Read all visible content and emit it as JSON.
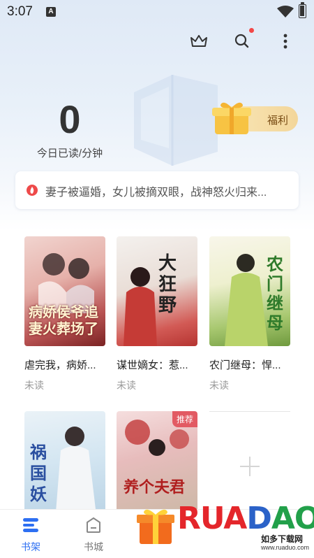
{
  "status_bar": {
    "time": "3:07",
    "notification_badge": "A"
  },
  "top_actions": [
    "crown-icon",
    "search-icon",
    "more-icon"
  ],
  "reading": {
    "count": "0",
    "label": "今日已读/分钟"
  },
  "welfare": {
    "label": "福利"
  },
  "banner": {
    "text": "妻子被逼婚，女儿被摘双眼，战神怒火归来..."
  },
  "books": [
    {
      "title": "虐完我，病娇...",
      "status": "未读",
      "cover_text": "病娇侯爷追妻火葬场了",
      "cover_tag": ""
    },
    {
      "title": "谋世嫡女：惹...",
      "status": "未读",
      "cover_text": "大狂野",
      "cover_tag": ""
    },
    {
      "title": "农门继母：悍...",
      "status": "未读",
      "cover_text": "农门继母",
      "cover_tag": ""
    },
    {
      "title": "",
      "status": "",
      "cover_text": "祸国妖",
      "cover_tag": ""
    },
    {
      "title": "",
      "status": "",
      "cover_text": "养个夫君",
      "cover_tag": "推荐"
    }
  ],
  "nav": {
    "shelf": "书架",
    "store": "书城"
  },
  "watermark": {
    "brand": "RUANDAO",
    "sub": "如多下载网",
    "url": "www.ruaduo.com"
  },
  "colors": {
    "accent": "#2d6ff2",
    "welfare_bg": "#f3d69a",
    "banner_icon": "#ee4a4a"
  }
}
